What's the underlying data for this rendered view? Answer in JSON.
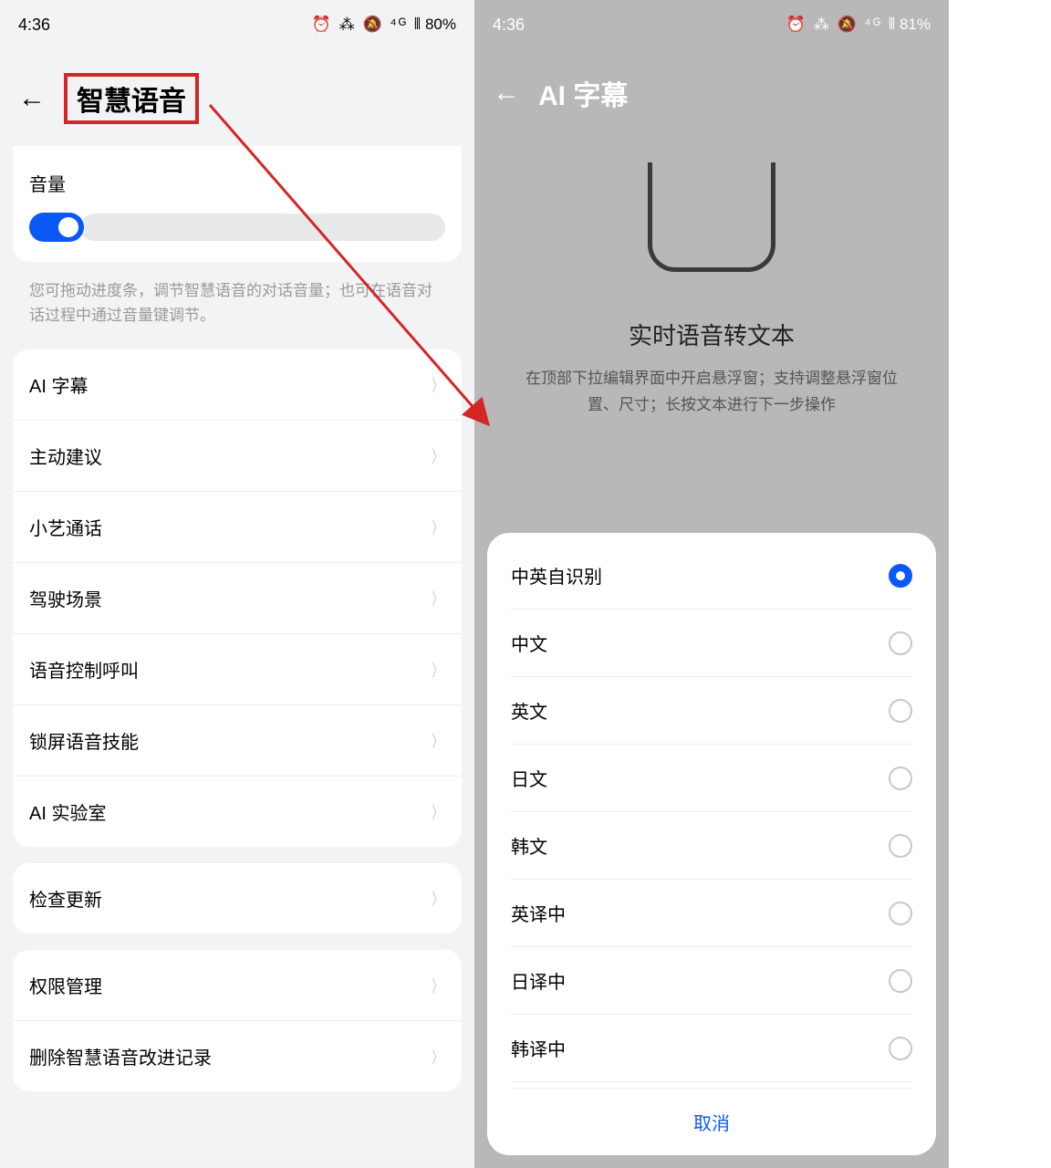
{
  "left": {
    "status": {
      "time": "4:36",
      "icons": "⏰ ⁂ 🔕 ⁴ᴳ ⫴",
      "battery": "80%"
    },
    "header_title": "智慧语音",
    "volume_label": "音量",
    "hint": "您可拖动进度条，调节智慧语音的对话音量；也可在语音对话过程中通过音量键调节。",
    "group1": [
      "AI 字幕",
      "主动建议",
      "小艺通话",
      "驾驶场景",
      "语音控制呼叫",
      "锁屏语音技能",
      "AI 实验室"
    ],
    "group2": [
      "检查更新"
    ],
    "group3": [
      "权限管理",
      "删除智慧语音改进记录"
    ]
  },
  "right": {
    "status": {
      "time": "4:36",
      "icons": "⏰ ⁂ 🔕 ⁴ᴳ ⫴",
      "battery": "81%"
    },
    "header_title": "AI 字幕",
    "info_title": "实时语音转文本",
    "info_desc": "在顶部下拉编辑界面中开启悬浮窗；支持调整悬浮窗位置、尺寸；长按文本进行下一步操作",
    "options": [
      "中英自识别",
      "中文",
      "英文",
      "日文",
      "韩文",
      "英译中",
      "日译中",
      "韩译中"
    ],
    "selected_index": 0,
    "cancel": "取消"
  }
}
